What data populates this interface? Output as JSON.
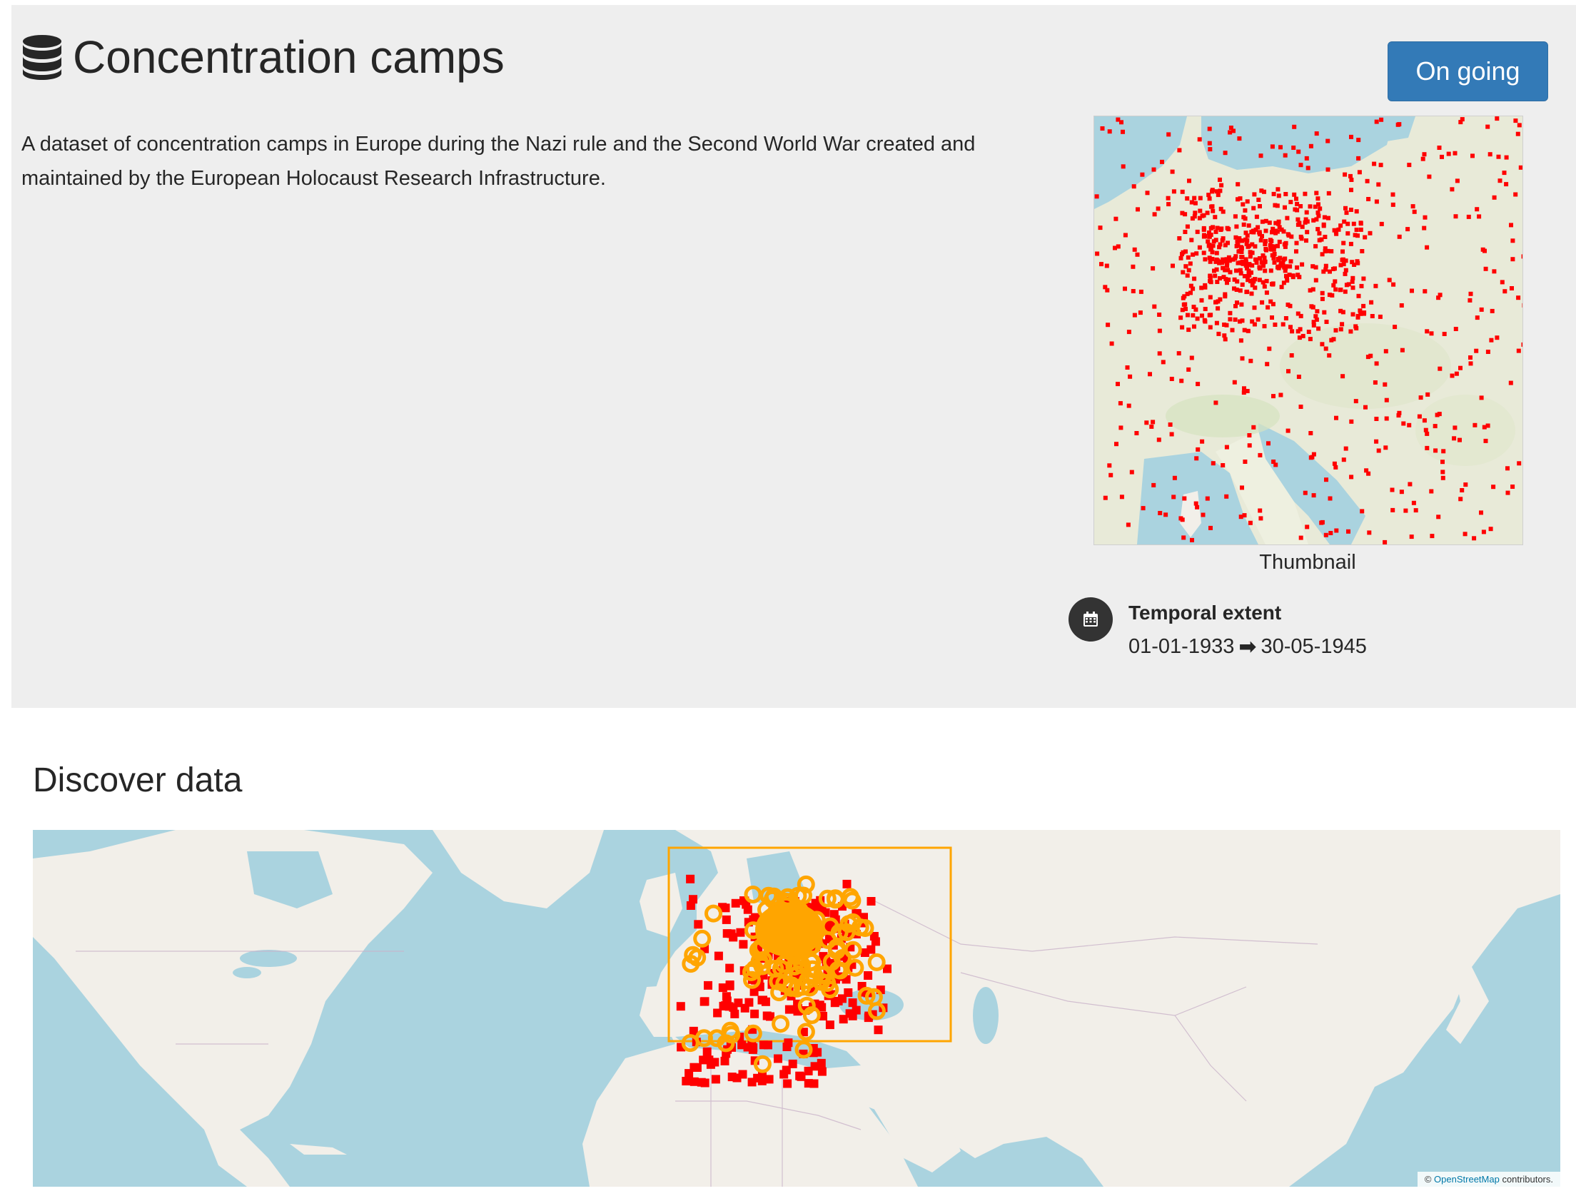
{
  "header": {
    "title": "Concentration camps",
    "title_icon": "database-icon",
    "status_label": "On going",
    "description": "A dataset of concentration camps in Europe during the Nazi rule and the Second World War created and maintained by the European Holocaust Research Infrastructure."
  },
  "thumbnail": {
    "caption": "Thumbnail"
  },
  "temporal_extent": {
    "label": "Temporal extent",
    "start": "01-01-1933",
    "end": "30-05-1945",
    "icon": "calendar-icon",
    "arrow_icon": "arrow-right-icon"
  },
  "discover": {
    "title": "Discover data"
  },
  "map": {
    "attribution_prefix": "©",
    "attribution_link": "OpenStreetMap",
    "attribution_suffix": "contributors.",
    "marker_color": "#ff0000",
    "cluster_color": "#ffa500",
    "extent_color": "#ffa500",
    "water_color": "#aad3df",
    "land_color": "#f2efe9"
  },
  "colors": {
    "status_button": "#337ab7",
    "panel_background": "#eeeeee"
  }
}
